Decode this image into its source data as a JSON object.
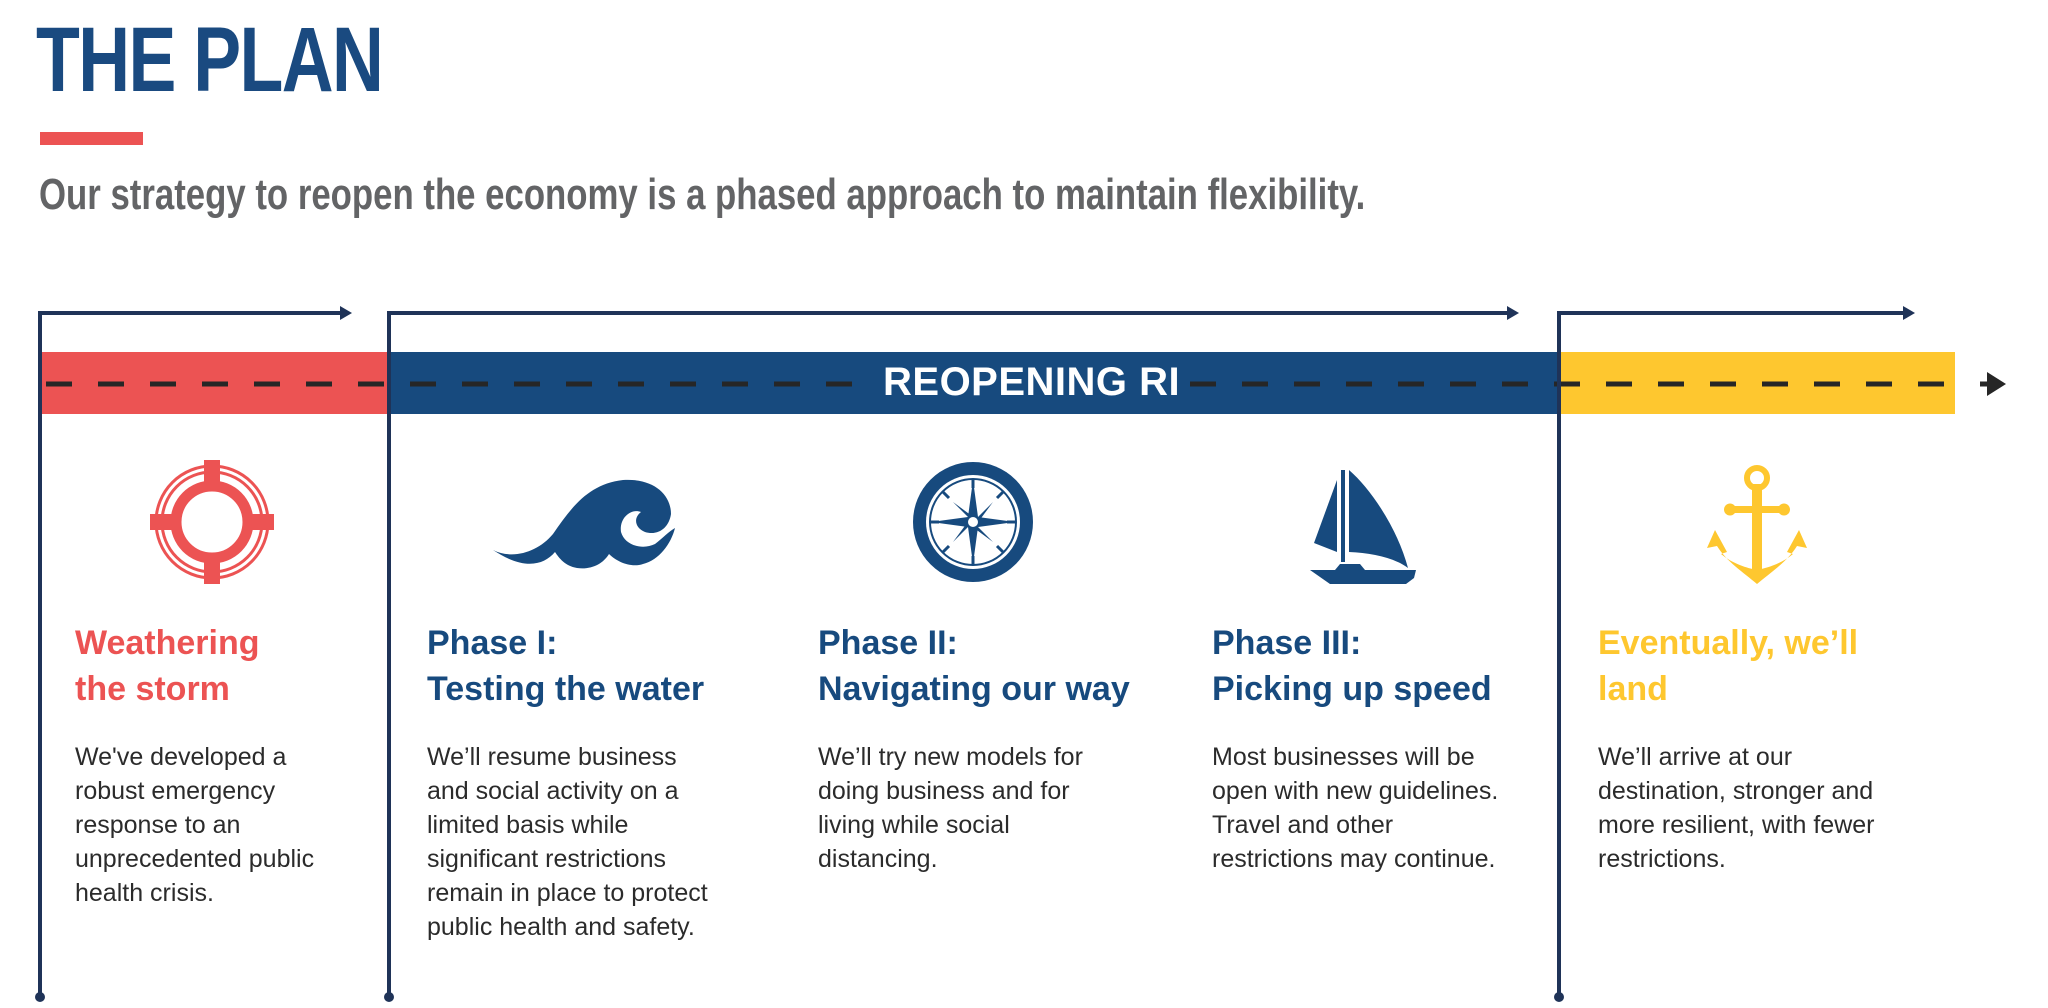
{
  "header": {
    "title": "THE PLAN",
    "subtitle": "Our strategy to reopen the economy is a phased approach to maintain flexibility."
  },
  "timeline": {
    "band_label": "REOPENING RI",
    "colors": {
      "red": "#ec5353",
      "blue": "#174a7e",
      "yellow": "#fec72f",
      "bracket": "#1f3358",
      "dash": "#262626"
    }
  },
  "stages": [
    {
      "icon": "life-ring-icon",
      "heading_line1": "Weathering",
      "heading_line2": "the storm",
      "color": "#ec5353",
      "body_lines": [
        "We've developed a",
        "robust emergency",
        "response to an",
        "unprecedented public",
        "health crisis."
      ]
    },
    {
      "icon": "wave-icon",
      "heading_line1": "Phase I:",
      "heading_line2": "Testing the water",
      "color": "#174a7e",
      "body_lines": [
        "We’ll resume business",
        "and social activity on a",
        "limited basis while",
        "significant restrictions",
        "remain in place to protect",
        "public health and safety."
      ]
    },
    {
      "icon": "compass-icon",
      "heading_line1": "Phase II:",
      "heading_line2": "Navigating our way",
      "color": "#174a7e",
      "body_lines": [
        "We’ll try new models for",
        "doing business and for",
        "living while social",
        "distancing."
      ]
    },
    {
      "icon": "sailboat-icon",
      "heading_line1": "Phase III:",
      "heading_line2": "Picking up speed",
      "color": "#174a7e",
      "body_lines": [
        "Most businesses will be",
        "open with new guidelines.",
        "Travel and other",
        "restrictions may continue."
      ]
    },
    {
      "icon": "anchor-icon",
      "heading_line1": "Eventually, we’ll",
      "heading_line2": "land",
      "color": "#fec72f",
      "body_lines": [
        "We’ll arrive at our",
        "destination, stronger and",
        "more resilient, with fewer",
        "restrictions."
      ]
    }
  ]
}
